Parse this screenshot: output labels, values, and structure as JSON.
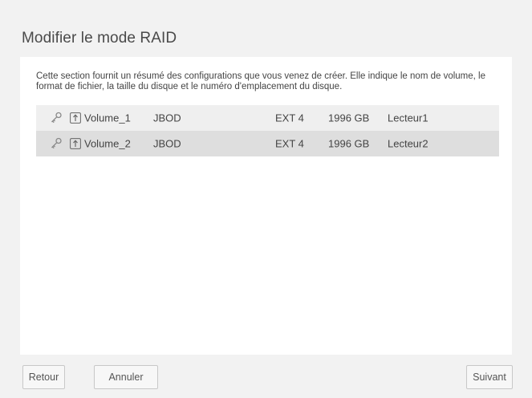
{
  "dialog": {
    "title": "Modifier le mode RAID",
    "description": "Cette section fournit un résumé des configurations que vous venez de créer. Elle indique le nom de volume, le format de fichier, la taille du disque et le numéro d'emplacement du disque."
  },
  "volumes": [
    {
      "name": "Volume_1",
      "type": "JBOD",
      "format": "EXT 4",
      "size": "1996 GB",
      "location": "Lecteur1"
    },
    {
      "name": "Volume_2",
      "type": "JBOD",
      "format": "EXT 4",
      "size": "1996 GB",
      "location": "Lecteur2"
    }
  ],
  "icons": {
    "key": "key-icon",
    "upload": "upload-icon"
  },
  "buttons": {
    "back": "Retour",
    "cancel": "Annuler",
    "next": "Suivant"
  },
  "colors": {
    "page_background": "#f2f2f2",
    "panel_background": "#ffffff",
    "row_odd": "#efefef",
    "row_even": "#dedede"
  }
}
